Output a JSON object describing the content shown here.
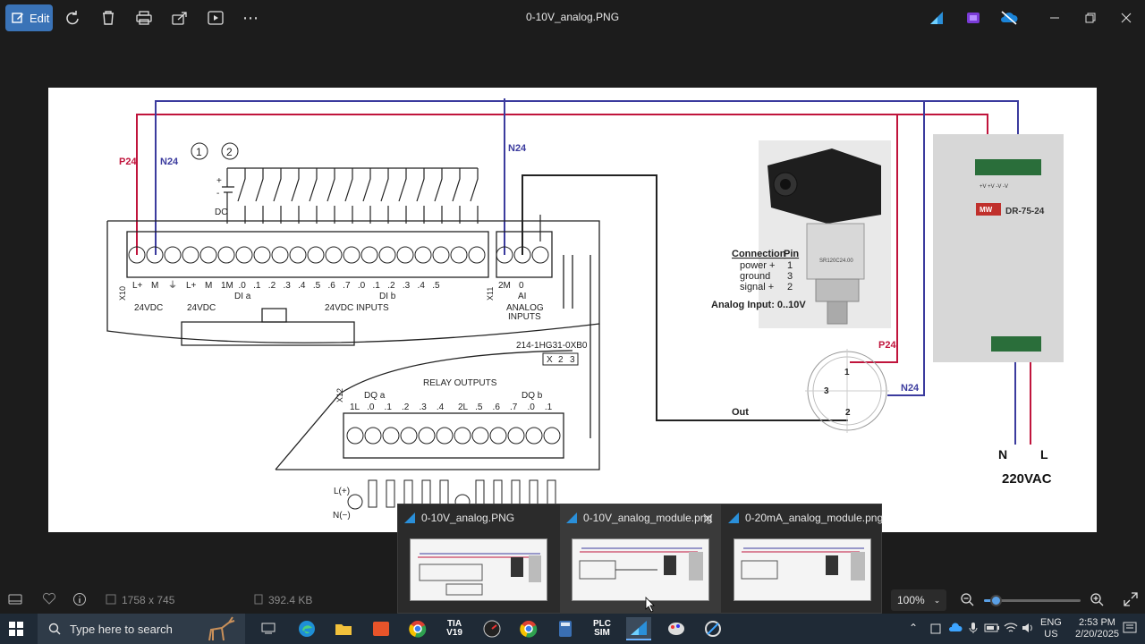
{
  "toolbar": {
    "edit_label": "Edit",
    "window_title": "0-10V_analog.PNG"
  },
  "diagram": {
    "p24_left": "P24",
    "n24_left": "N24",
    "n24_mid": "N24",
    "circle1": "1",
    "circle2": "2",
    "dc_plus": "+",
    "dc_minus": "-",
    "dc_label": "DC",
    "x10": "X10",
    "x11": "X11",
    "x12": "X12",
    "lplus1": "L+",
    "m1": "M",
    "ground_sym": "⏚",
    "lplus2": "L+",
    "m2": "M",
    "inputs_row": "1M  .0   .1   .2   .3   .4   .5   .6   .7   .0   .1   .2   .3   .4   .5",
    "dia": "DI a",
    "dib": "DI b",
    "vdc1": "24VDC",
    "vdc2": "24VDC",
    "vdc_inputs": "24VDC INPUTS",
    "ai_2m": "2M",
    "ai_0": "0",
    "ai_label": "AI",
    "analog_inputs_1": "ANALOG",
    "analog_inputs_2": "INPUTS",
    "model": "214-1HG31-0XB0",
    "model_x": "X",
    "model_2": "2",
    "model_3": "3",
    "relay_outputs": "RELAY OUTPUTS",
    "dqa": "DQ a",
    "dqb": "DQ b",
    "relay_row_a": "1L   .0    .1    .2    .3    .4",
    "relay_row_b": "2L   .5    .6    .7    .0    .1",
    "l_plus": "L(+)",
    "n_minus": "N(−)",
    "conn_header": "Connection",
    "pin_header": "Pin",
    "conn_rows": [
      {
        "name": "power +",
        "pin": "1"
      },
      {
        "name": "ground",
        "pin": "3"
      },
      {
        "name": "signal +",
        "pin": "2"
      }
    ],
    "analog_input_note": "Analog Input: 0..10V",
    "p24_right": "P24",
    "n24_right": "N24",
    "pin1": "1",
    "pin2": "2",
    "pin3": "3",
    "out_label": "Out",
    "psu_model": "DR-75-24",
    "psu_brand": "MW",
    "psu_terminals_top": "+V  +V  -V  -V",
    "n_label": "N",
    "l_label": "L",
    "vac": "220VAC",
    "sensor_label": "SR120C24.00"
  },
  "thumbnails": [
    {
      "title": "0-10V_analog.PNG"
    },
    {
      "title": "0-10V_analog_module.png"
    },
    {
      "title": "0-20mA_analog_module.png"
    }
  ],
  "statusbar": {
    "dimensions": "1758 x 745",
    "file_size": "392.4 KB",
    "zoom": "100%",
    "zoom_level": 0.12
  },
  "taskbar": {
    "search_placeholder": "Type here to search",
    "apps": [
      {
        "label": "TIA\nV19",
        "color": "#ffffff"
      },
      {
        "label": "PLC\nSIM",
        "color": "#ffffff"
      }
    ],
    "lang_top": "ENG",
    "lang_bottom": "US",
    "time": "2:53 PM",
    "date": "2/20/2025",
    "tia_line1": "TIA",
    "tia_line2": "V19",
    "plc_line1": "PLC",
    "plc_line2": "SIM"
  },
  "colors": {
    "accent": "#3a73b7",
    "p24_red": "#c0143c",
    "n24_blue": "#3b3b9e",
    "taskbar": "#1f2a36"
  }
}
